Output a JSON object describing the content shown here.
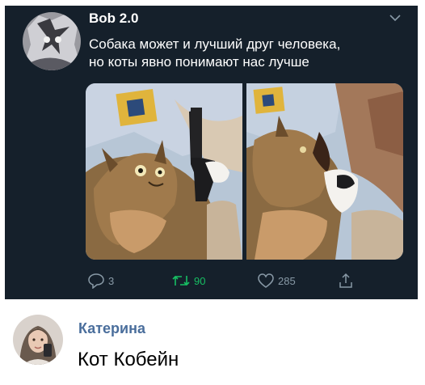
{
  "tweet": {
    "author": "Bob 2.0",
    "text_line1": "Собака может и лучший друг человека,",
    "text_line2": "но коты явно понимают нас лучше",
    "replies": "3",
    "retweets": "90",
    "likes": "285",
    "colors": {
      "background": "#15202b",
      "text": "#ffffff",
      "muted": "#8899a6",
      "retweet": "#17bf63"
    }
  },
  "comment": {
    "author": "Катерина",
    "text": "Кот Кобейн",
    "colors": {
      "name": "#4a6e9c"
    }
  },
  "icons": [
    "chevron-down-icon",
    "reply-icon",
    "retweet-icon",
    "like-icon",
    "share-icon"
  ]
}
